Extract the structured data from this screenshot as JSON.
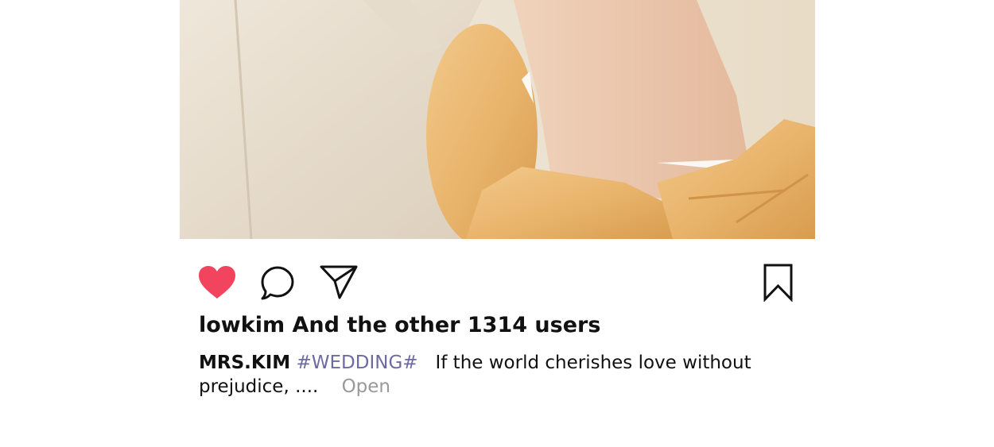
{
  "post": {
    "likes_text": "lowkim And the other 1314 users",
    "caption": {
      "username": "MRS.KIM",
      "hashtag": "#WEDDING#",
      "text": "If the world cherishes love without prejudice, ....",
      "more_label": "Open"
    }
  },
  "icons": {
    "like": "heart-icon",
    "comment": "speech-bubble-icon",
    "share": "paper-plane-icon",
    "save": "bookmark-icon"
  },
  "colors": {
    "liked_heart": "#f3445f",
    "hashtag": "#6e6aa2",
    "open_link": "#999999",
    "text": "#111111"
  }
}
